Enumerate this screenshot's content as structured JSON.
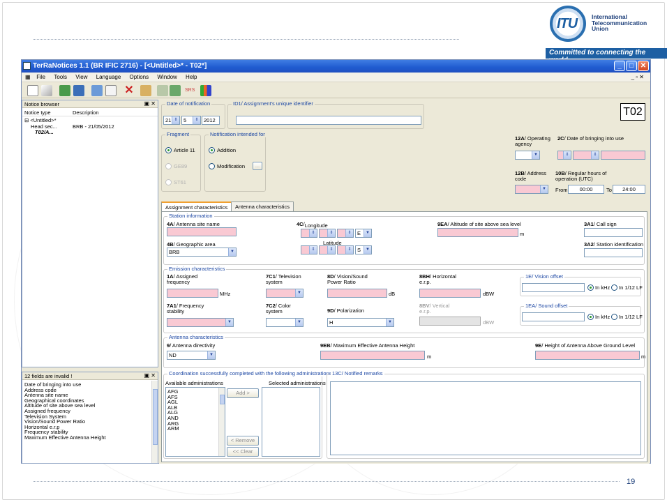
{
  "slide": {
    "page_number": "19"
  },
  "logo": {
    "line1": "International",
    "line2": "Telecommunication",
    "line3": "Union",
    "tagline": "Committed to connecting the world"
  },
  "window": {
    "title": "TerRaNotices 1.1 (BR IFIC 2716) - [<Untitled>* - T02*]"
  },
  "menu": [
    "File",
    "Tools",
    "View",
    "Language",
    "Options",
    "Window",
    "Help"
  ],
  "notice_browser": {
    "title": "Notice browser",
    "col_type": "Notice type",
    "col_desc": "Description",
    "root": "<Untitled>*",
    "child1_type": "Head sec...",
    "child1_desc": "BRB - 21/05/2012",
    "child2": "T02/A..."
  },
  "invalid_panel": {
    "title": "12 fields are invalid !",
    "items": [
      "Date of bringing into use",
      "Address code",
      "Antenna site name",
      "Geographical coordinates",
      "Altitude of site above sea level",
      "Assigned frequency",
      "Television System",
      "Vision/Sound Power Ratio",
      "Horizontal e.r.p",
      "Frequency stability",
      "Maximum Effective Antenna Height"
    ]
  },
  "form": {
    "form_code": "T02",
    "date_of_notification": {
      "label": "Date of notification",
      "day": "21",
      "month": "5",
      "year": "2012"
    },
    "id1": {
      "label": "ID1/ Assignment's unique identifier",
      "value": ""
    },
    "fragment": {
      "label": "Fragment",
      "options": [
        "Article 11",
        "GE89",
        "ST61"
      ],
      "selected": "Article 11"
    },
    "notification_for": {
      "label": "Notification intended for",
      "options": [
        "Addition",
        "Modification"
      ],
      "selected": "Addition",
      "ellipsis": "..."
    },
    "agency": {
      "code": "12A",
      "label": "/ Operating agency"
    },
    "date_bringing": {
      "code": "2C",
      "label": "/ Date of bringing into use"
    },
    "address_code": {
      "code": "12B",
      "label": "/ Address code"
    },
    "hours": {
      "code": "10B",
      "label": "/ Regular hours of operation (UTC)",
      "from_label": "From",
      "from": "00:00",
      "to_label": "To",
      "to": "24:00"
    },
    "tabs": [
      "Assignment characteristics",
      "Antenna characteristics"
    ],
    "station": {
      "group": "Station information",
      "site_name": {
        "code": "4A",
        "label": "/ Antenna site name"
      },
      "coords": {
        "code": "4C",
        "label": "/",
        "longitude_label": "Longitude",
        "latitude_label": "Latitude",
        "ew": "E",
        "ns": "S"
      },
      "altitude": {
        "code": "9EA",
        "label": "/ Altitude of site above sea level",
        "unit": "m"
      },
      "call_sign": {
        "code": "3A1",
        "label": "/ Call sign"
      },
      "geo_area": {
        "code": "4B",
        "label": "/ Geographic area",
        "value": "BRB"
      },
      "station_id": {
        "code": "3A2",
        "label": "/ Station identification"
      }
    },
    "emission": {
      "group": "Emission characteristics",
      "assigned_freq": {
        "code": "1A",
        "label": "/ Assigned frequency",
        "unit": "MHz"
      },
      "tv_system": {
        "code": "7C1",
        "label": "/ Television system"
      },
      "power_ratio": {
        "code": "8D",
        "label": "/ Vision/Sound Power Ratio",
        "unit": "dB"
      },
      "horiz_erp": {
        "code": "8BH",
        "label": "/ Horizontal e.r.p.",
        "unit": "dBW"
      },
      "vision_offset": {
        "code": "1E",
        "label": "/ Vision offset",
        "opt1": "In kHz",
        "opt2": "In 1/12 LF"
      },
      "freq_stability": {
        "code": "7A1",
        "label": "/ Frequency stability"
      },
      "color_system": {
        "code": "7C2",
        "label": "/ Color system"
      },
      "polarization": {
        "code": "9D",
        "label": "/ Polarization",
        "value": "H"
      },
      "vert_erp": {
        "code": "8BV",
        "label": "/ Vertical e.r.p.",
        "unit": "dBW"
      },
      "sound_offset": {
        "code": "1EA",
        "label": "/ Sound offset",
        "opt1": "In kHz",
        "opt2": "In 1/12 LF"
      }
    },
    "antenna": {
      "group": "Antenna characteristics",
      "directivity": {
        "code": "9",
        "label": "/ Antenna directivity",
        "value": "ND"
      },
      "max_height": {
        "code": "9EB",
        "label": "/ Maximum Effective Antenna Height",
        "unit": "m"
      },
      "ground_height": {
        "code": "9E",
        "label": "/ Height of Antenna Above Ground Level",
        "unit": "m"
      }
    },
    "coordination": {
      "group": "Coordination successfully completed with the following administrations",
      "available_label": "Available administrations",
      "selected_label": "Selected administrations",
      "available": [
        "AFG",
        "AFS",
        "AGL",
        "ALB",
        "ALG",
        "AND",
        "ARG",
        "ARM"
      ],
      "add": "Add >",
      "remove": "< Remove",
      "clear": "<< Clear"
    },
    "remarks": {
      "code": "13C",
      "label": "/ Notified remarks"
    }
  }
}
